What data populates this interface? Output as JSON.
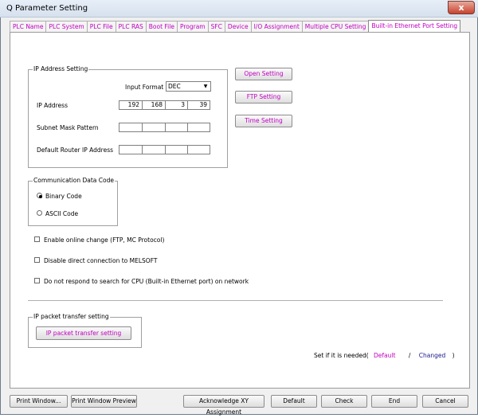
{
  "window": {
    "title": "Q Parameter Setting",
    "close_glyph": "x"
  },
  "tabs": [
    {
      "label": "PLC Name"
    },
    {
      "label": "PLC System"
    },
    {
      "label": "PLC File"
    },
    {
      "label": "PLC RAS"
    },
    {
      "label": "Boot File"
    },
    {
      "label": "Program"
    },
    {
      "label": "SFC"
    },
    {
      "label": "Device"
    },
    {
      "label": "I/O Assignment"
    },
    {
      "label": "Multiple CPU Setting"
    },
    {
      "label": "Built-in Ethernet Port Setting"
    }
  ],
  "ip_setting": {
    "group_label": "IP Address Setting",
    "input_format_label": "Input Format",
    "input_format_value": "DEC",
    "ip_address_label": "IP Address",
    "ip_address": [
      "192",
      "168",
      "3",
      "39"
    ],
    "subnet_label": "Subnet Mask Pattern",
    "subnet": [
      "",
      "",
      "",
      ""
    ],
    "router_label": "Default Router IP Address",
    "router": [
      "",
      "",
      "",
      ""
    ]
  },
  "side_buttons": {
    "open": "Open Setting",
    "ftp": "FTP Setting",
    "time": "Time Setting"
  },
  "comm_code": {
    "group_label": "Communication Data Code",
    "binary": "Binary Code",
    "ascii": "ASCII Code",
    "selected": "binary"
  },
  "checkboxes": {
    "online_change": "Enable online change (FTP, MC Protocol)",
    "disable_direct": "Disable direct connection to MELSOFT",
    "no_respond": "Do not respond to search for CPU (Built-in Ethernet port) on network"
  },
  "packet": {
    "group_label": "IP packet transfer setting",
    "button": "IP packet transfer setting"
  },
  "legend": {
    "prefix": "Set if it is needed(",
    "default": "Default",
    "slash": "/",
    "changed": "Changed",
    "suffix": ")",
    "default_color": "#c000c0",
    "changed_color": "#1a1a8a"
  },
  "footer": {
    "print_window": "Print Window...",
    "print_preview": "Print Window Preview",
    "acknowledge": "Acknowledge XY Assignment",
    "default": "Default",
    "check": "Check",
    "end": "End",
    "cancel": "Cancel"
  }
}
